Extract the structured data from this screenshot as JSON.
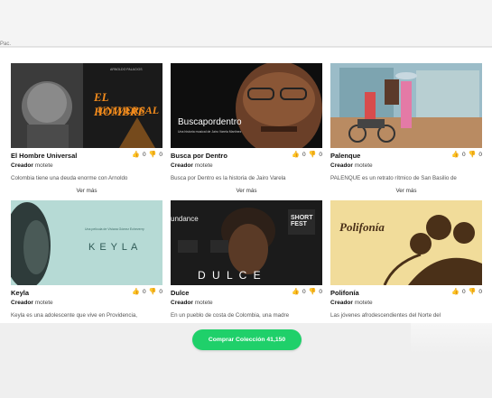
{
  "header": {
    "fragment": "Pac."
  },
  "cards": [
    {
      "title": "El Hombre Universal",
      "creator_label": "Creador",
      "creator": "motete",
      "likes": "0",
      "dislikes": "0",
      "description": "Colombia tiene una deuda enorme con Arnoldo",
      "more": "Ver más",
      "thumb_lines": [
        "EL HOMBRE",
        "UNIVERSAL"
      ],
      "thumb_small": "ARNOLDO PALACIOS"
    },
    {
      "title": "Busca por Dentro",
      "creator_label": "Creador",
      "creator": "motete",
      "likes": "0",
      "dislikes": "0",
      "description": "Busca por Dentro es la historia de Jairo Varela",
      "more": "Ver más",
      "thumb_lines": [
        "Buscapordentro"
      ],
      "thumb_small": "Una historia musical de Jairo Varela Martínez"
    },
    {
      "title": "Palenque",
      "creator_label": "Creador",
      "creator": "motete",
      "likes": "0",
      "dislikes": "0",
      "description": "PALENQUE es un retrato rítmico de San Basilio de",
      "more": "Ver más",
      "thumb_lines": [],
      "thumb_small": ""
    },
    {
      "title": "Keyla",
      "creator_label": "Creador",
      "creator": "motete",
      "likes": "0",
      "dislikes": "0",
      "description": "Keyla es una adolescente que vive en Providencia,",
      "more": "",
      "thumb_lines": [
        "K E Y L A"
      ],
      "thumb_small": "Una película de Viviana Gómez Echeverry"
    },
    {
      "title": "Dulce",
      "creator_label": "Creador",
      "creator": "motete",
      "likes": "0",
      "dislikes": "0",
      "description": "En un pueblo de costa de Colombia, una madre",
      "more": "",
      "thumb_lines": [
        "D U L C E"
      ],
      "thumb_small": "undance"
    },
    {
      "title": "Polifonía",
      "creator_label": "Creador",
      "creator": "motete",
      "likes": "0",
      "dislikes": "0",
      "description": "Las jóvenes afrodescendientes del Norte del",
      "more": "",
      "thumb_lines": [
        "Polifonía"
      ],
      "thumb_small": ""
    }
  ],
  "buy_button": {
    "label": "Comprar Colección 41,150"
  },
  "colors": {
    "accent": "#1fd06a",
    "orange_title": "#f08a1c",
    "keyla_teal": "#7fb8b0"
  }
}
